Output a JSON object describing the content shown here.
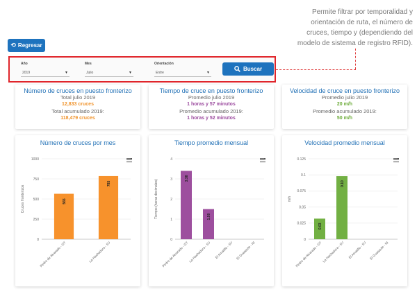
{
  "annotation": {
    "lines": [
      "Permite filtrar por temporalidad y",
      "orientación de ruta, el número de",
      "cruces, tiempo y (dependiendo del",
      "modelo de sistema de registro RFID)."
    ]
  },
  "back_button": {
    "icon": "undo-icon",
    "label": "Regresar"
  },
  "filters": {
    "year": {
      "label": "Año",
      "value": "2019"
    },
    "month": {
      "label": "Mes",
      "value": "Julio"
    },
    "orientation": {
      "label": "Orientación",
      "value": "Entre"
    },
    "search_label": "Buscar",
    "highlight_color": "#e0252b"
  },
  "kpis": [
    {
      "title": "Número de cruces en puesto fronterizo",
      "line1": "Total julio 2019",
      "value1": "12,833 cruces",
      "line2": "Total acumulado 2019:",
      "value2": "118,479 cruces",
      "color": "#f0932b"
    },
    {
      "title": "Tiempo de cruce en puesto fronterizo",
      "line1": "Promedio julio 2019",
      "value1": "1 horas y 57 minutos",
      "line2": "Promedio acumulado 2019:",
      "value2": "1 horas y 52 minutos",
      "color": "#9b4a9e"
    },
    {
      "title": "Velocidad de cruce en puesto fronterizo",
      "line1": "Promedio julio 2019",
      "value1": "20 m/h",
      "line2": "Promedio acumulado 2019:",
      "value2": "50 m/h",
      "color": "#6aaa36"
    }
  ],
  "chart_data": [
    {
      "type": "bar",
      "title": "Número de cruces por mes",
      "ylabel": "Cruces fronterizos",
      "xlabel": "",
      "categories": [
        "Pedro de Alvarado - GT",
        "La Hachadura - SV"
      ],
      "values": [
        565,
        785
      ],
      "labels": [
        "565",
        "785"
      ],
      "ylim": [
        0,
        1000
      ],
      "yticks": [
        0,
        250,
        500,
        750,
        1000
      ],
      "ytick_labels": [
        "0",
        "250",
        "500",
        "750",
        "1000"
      ],
      "color": "#f7922c",
      "grid": true
    },
    {
      "type": "bar",
      "title": "Tiempo promedio mensual",
      "ylabel": "Tiempo (horas decimales)",
      "xlabel": "",
      "categories": [
        "Pedro de Alvarado - GT",
        "La Hachadura - SV",
        "El Amatillo - SV",
        "El Guasaule - NI"
      ],
      "values": [
        3.4,
        1.5,
        0,
        0
      ],
      "labels": [
        "3.38",
        "1.50",
        "",
        ""
      ],
      "ylim": [
        0,
        4
      ],
      "yticks": [
        0,
        1,
        2,
        3,
        4
      ],
      "ytick_labels": [
        "0",
        "1",
        "2",
        "3",
        "4"
      ],
      "color": "#9d4f9e",
      "grid": true
    },
    {
      "type": "bar",
      "title": "Velocidad promedio mensual",
      "ylabel": "m/h",
      "xlabel": "",
      "categories": [
        "Pedro de Alvarado - GT",
        "La Hachadura - SV",
        "El Amatillo - SV",
        "El Guasaule - NI"
      ],
      "values": [
        0.032,
        0.098,
        0,
        0
      ],
      "labels": [
        "0.03",
        "0.10",
        "",
        ""
      ],
      "ylim": [
        0,
        0.125
      ],
      "yticks": [
        0,
        0.025,
        0.05,
        0.075,
        0.1,
        0.125
      ],
      "ytick_labels": [
        "0",
        "0.025",
        "0.05",
        "0.075",
        "0.1",
        "0.125"
      ],
      "color": "#72b043",
      "grid": true
    }
  ]
}
